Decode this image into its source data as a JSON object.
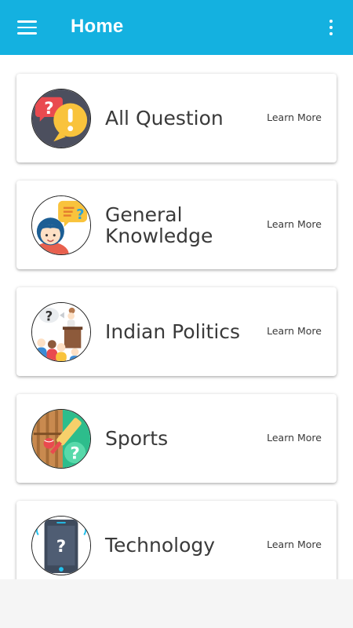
{
  "header": {
    "title": "Home",
    "menu_icon": "hamburger-menu-icon",
    "overflow_icon": "overflow-menu-icon",
    "background": "#14b1e0"
  },
  "categories": [
    {
      "title": "All Question",
      "action": "Learn More",
      "icon": "question-exclamation-bubbles-icon"
    },
    {
      "title": "General Knowledge",
      "action": "Learn More",
      "icon": "girl-thinking-icon"
    },
    {
      "title": "Indian Politics",
      "action": "Learn More",
      "icon": "politician-podium-icon"
    },
    {
      "title": "Sports",
      "action": "Learn More",
      "icon": "cricket-bat-ball-icon"
    },
    {
      "title": "Technology",
      "action": "Learn More",
      "icon": "phone-question-icon"
    }
  ]
}
